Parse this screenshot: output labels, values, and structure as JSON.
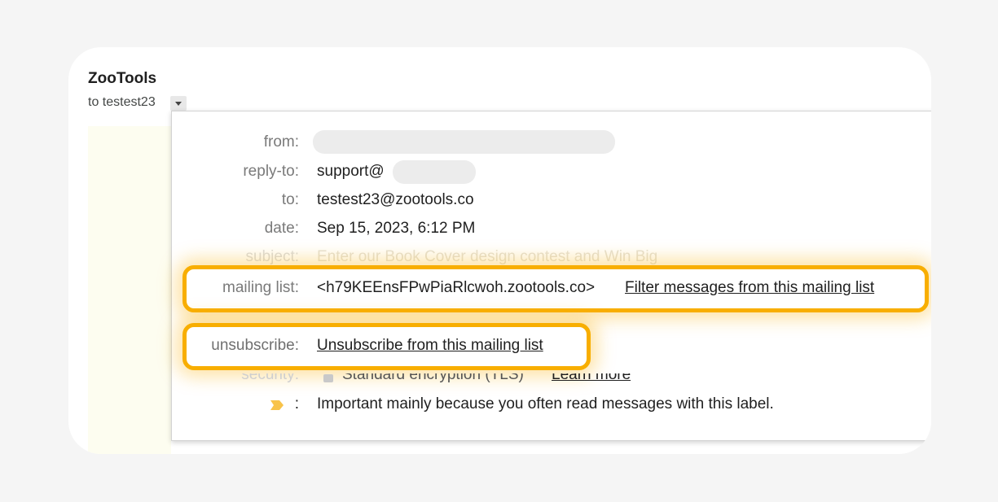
{
  "email": {
    "sender_name": "ZooTools",
    "recipient_short": "to testest23"
  },
  "details": {
    "from_label": "from:",
    "reply_to_label": "reply-to:",
    "reply_to_value": "support@",
    "to_label": "to:",
    "to_value": "testest23@zootools.co",
    "date_label": "date:",
    "date_value": "Sep 15, 2023, 6:12 PM",
    "subject_label": "subject:",
    "subject_value": "Enter our Book Cover design contest and Win Big",
    "mailing_list_label": "mailing list:",
    "mailing_list_value": "<h79KEEnsFPwPiaRlcwoh.zootools.co>",
    "mailing_list_link": "Filter messages from this mailing list",
    "unsubscribe_label": "unsubscribe:",
    "unsubscribe_link": "Unsubscribe from this mailing list",
    "security_label": "security:",
    "security_value": "Standard encryption (TLS)",
    "security_link": "Learn more",
    "importance_value": "Important mainly because you often read messages with this label."
  },
  "colors": {
    "highlight": "#f8ae00",
    "importance_marker": "#f8c34a"
  }
}
